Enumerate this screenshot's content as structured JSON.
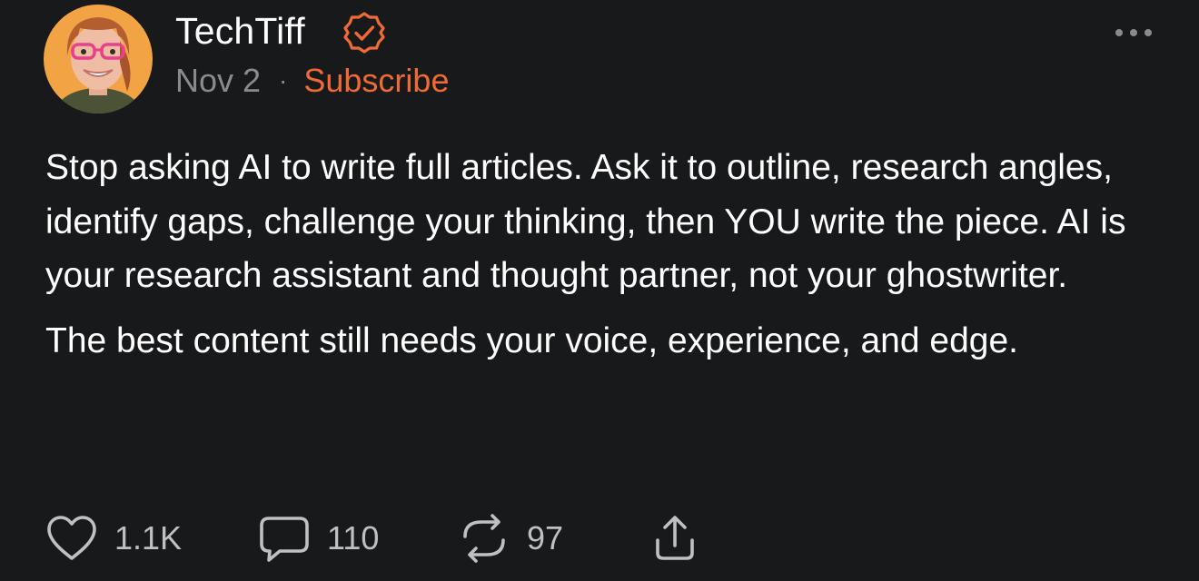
{
  "post": {
    "author": {
      "name": "TechTiff",
      "verified_icon": "verified-badge-icon"
    },
    "date": "Nov 2",
    "separator": "·",
    "subscribe_label": "Subscribe",
    "more_icon": "more-horizontal-icon",
    "body": {
      "paragraph_1": "Stop asking AI to write full articles. Ask it to outline, research angles, identify gaps, challenge your thinking, then YOU write the piece. AI is your research assistant and thought partner, not your ghostwriter.",
      "paragraph_2": "The best content still needs your voice, experience, and edge."
    },
    "actions": {
      "likes": "1.1K",
      "comments": "110",
      "restacks": "97",
      "like_icon": "heart-icon",
      "comment_icon": "comment-icon",
      "restack_icon": "restack-icon",
      "share_icon": "share-icon"
    },
    "colors": {
      "background": "#18191b",
      "accent": "#ef6a34",
      "muted_text": "#8a8b8e"
    }
  }
}
